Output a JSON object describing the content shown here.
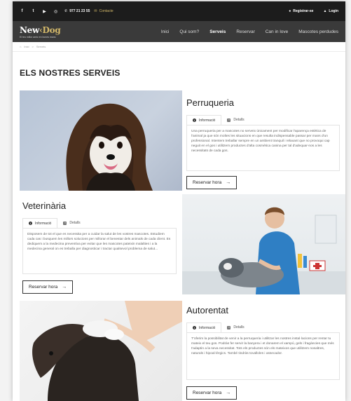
{
  "topbar": {
    "social": [
      "f",
      "t",
      "▶",
      "◎"
    ],
    "phone": "977 21 23 55",
    "contact": "Contacte",
    "register": "Registrar-se",
    "login": "Login"
  },
  "nav": {
    "logo_part1": "New",
    "logo_part2": "Dog",
    "logo_tagline": "El teu millor amic en bones mans",
    "menu": [
      "Inici",
      "Qui som?",
      "Serveis",
      "Reservar",
      "Can in love",
      "Mascotes perdudes"
    ],
    "active": "Serveis"
  },
  "breadcrumb": {
    "home": "Inici",
    "sep": ">",
    "current": "Serveis"
  },
  "page_title": "ELS NOSTRES SERVEIS",
  "services": [
    {
      "title": "Perruqueria",
      "tab_info": "Informació",
      "tab_details": "Detalls",
      "description": "Una perruqueria per a mascotes no serveix únicament per modificar l'aparença estètica de l'animal ja que són moltes les situacions en que resulta indispensable passar per mans d'un professional. Intentem treballar sempre en un ambient tranquil i relaxant que no provoqui cap neguit en el gos i utilitzem productes d'alta cosmètica canina per tal d'adequar-nos a les necessitats de cada gos.",
      "button": "Reservar hora"
    },
    {
      "title": "Veterinària",
      "tab_info": "Informació",
      "tab_details": "Detalls",
      "description": "Disposem de tot el que es necessita per a cuidar la salut de les vostres mascotes. Estudiem cada cas i busquem les millors solucions per millorar el benestar dels animals de cada client. Es dediquem a la medecina preventiva per evitar que les mascotes pateixin malalties i a la medecina general on es treballa per diagnosticar i tractar qualsevol problema de salut...",
      "button": "Reservar hora"
    },
    {
      "title": "Autorentat",
      "tab_info": "Informació",
      "tab_details": "Detalls",
      "description": "T'oferim la possibilitat de venir a la perruqueria i utilitzar les nostres instal·lacions per rentar tu mateix el teu gos. Podràs fer servir la banyera i et donarem el xampú, gels i fragàncies que més t'adaptin a la seva necessitat. Tots els productes són els mateixos que utilitzem nosaltres, naturals i hipoal·lèrgics. També tindràs tovalloles i assecador.",
      "button": "Reservar hora"
    }
  ]
}
